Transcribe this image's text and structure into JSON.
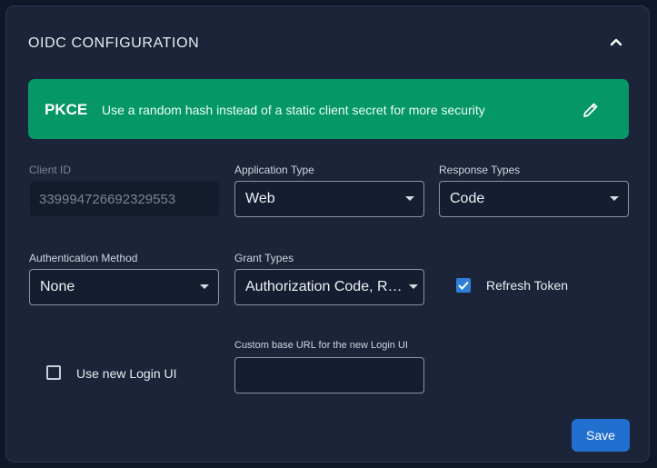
{
  "section": {
    "title": "OIDC CONFIGURATION"
  },
  "banner": {
    "title": "PKCE",
    "description": "Use a random hash instead of a static client secret for more security"
  },
  "fields": {
    "client_id": {
      "label": "Client ID",
      "value": "339994726692329553"
    },
    "application_type": {
      "label": "Application Type",
      "value": "Web"
    },
    "response_types": {
      "label": "Response Types",
      "value": "Code"
    },
    "auth_method": {
      "label": "Authentication Method",
      "value": "None"
    },
    "grant_types": {
      "label": "Grant Types",
      "value": "Authorization Code, Re..."
    },
    "refresh_token": {
      "label": "Refresh Token",
      "checked": true
    },
    "use_new_login": {
      "label": "Use new Login UI",
      "checked": false
    },
    "custom_base_url": {
      "label": "Custom base URL for the new Login UI",
      "value": ""
    }
  },
  "actions": {
    "save": "Save"
  },
  "icons": {
    "collapse": "chevron-up-icon",
    "edit": "pencil-icon",
    "dropdown": "caret-down-icon",
    "check": "check-icon"
  },
  "colors": {
    "background": "#0f1729",
    "panel": "#1b2438",
    "accent_banner": "#069766",
    "primary_button": "#2170d0",
    "checkbox_on": "#2f7fd8"
  }
}
